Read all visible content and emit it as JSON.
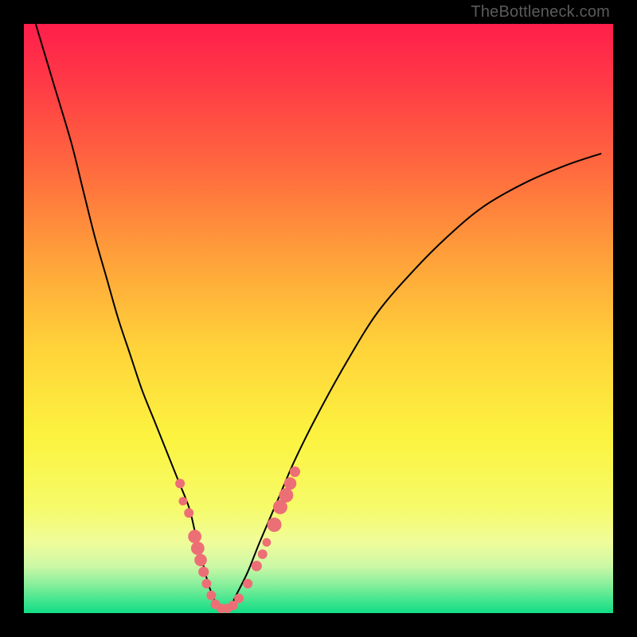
{
  "watermark": "TheBottleneck.com",
  "colors": {
    "frame_bg": "#000000",
    "curve_stroke": "#000000",
    "marker_fill": "#ED6F76",
    "marker_stroke": "#ED6F76",
    "gradient_stops": [
      {
        "pct": 0,
        "c": "#FF1E4B"
      },
      {
        "pct": 10,
        "c": "#FF3A46"
      },
      {
        "pct": 25,
        "c": "#FF6B3E"
      },
      {
        "pct": 40,
        "c": "#FFA23A"
      },
      {
        "pct": 55,
        "c": "#FFD33A"
      },
      {
        "pct": 70,
        "c": "#FCF33F"
      },
      {
        "pct": 82,
        "c": "#F6FB69"
      },
      {
        "pct": 88,
        "c": "#F0FC9A"
      },
      {
        "pct": 92,
        "c": "#CCF8A6"
      },
      {
        "pct": 95,
        "c": "#8BEF9C"
      },
      {
        "pct": 98,
        "c": "#3FE58E"
      },
      {
        "pct": 100,
        "c": "#12DC85"
      }
    ]
  },
  "chart_data": {
    "type": "line",
    "title": "",
    "xlabel": "",
    "ylabel": "",
    "xlim": [
      0,
      100
    ],
    "ylim": [
      0,
      100
    ],
    "note": "Axes are implied (no ticks). y=100 is top (red/worst), y=0 bottom (green/best). Curve depicts bottleneck % vs some x parameter.",
    "series": [
      {
        "name": "bottleneck-curve",
        "x": [
          2,
          5,
          8,
          10,
          12,
          14,
          16,
          18,
          20,
          22,
          24,
          26,
          28,
          29,
          30,
          31,
          32,
          33,
          34,
          35,
          36,
          38,
          40,
          43,
          46,
          50,
          55,
          60,
          66,
          72,
          78,
          85,
          92,
          98
        ],
        "y": [
          100,
          90,
          80,
          72,
          64,
          57,
          50,
          44,
          38,
          33,
          28,
          23,
          18,
          14,
          10,
          6,
          3,
          1,
          0.5,
          1,
          3,
          7,
          12,
          19,
          26,
          34,
          43,
          51,
          58,
          64,
          69,
          73,
          76,
          78
        ]
      }
    ],
    "markers": {
      "name": "highlighted-points",
      "points": [
        {
          "x": 26.5,
          "y": 22,
          "r": 1.0
        },
        {
          "x": 27.0,
          "y": 19,
          "r": 0.9
        },
        {
          "x": 28.0,
          "y": 17,
          "r": 1.0
        },
        {
          "x": 29.0,
          "y": 13,
          "r": 1.4
        },
        {
          "x": 29.5,
          "y": 11,
          "r": 1.4
        },
        {
          "x": 30.0,
          "y": 9,
          "r": 1.3
        },
        {
          "x": 30.5,
          "y": 7,
          "r": 1.1
        },
        {
          "x": 31.0,
          "y": 5,
          "r": 1.0
        },
        {
          "x": 31.8,
          "y": 3,
          "r": 1.0
        },
        {
          "x": 32.5,
          "y": 1.5,
          "r": 1.0
        },
        {
          "x": 33.5,
          "y": 0.8,
          "r": 1.0
        },
        {
          "x": 34.5,
          "y": 0.8,
          "r": 1.0
        },
        {
          "x": 35.5,
          "y": 1.3,
          "r": 1.0
        },
        {
          "x": 36.5,
          "y": 2.5,
          "r": 1.0
        },
        {
          "x": 38.0,
          "y": 5,
          "r": 1.0
        },
        {
          "x": 39.5,
          "y": 8,
          "r": 1.1
        },
        {
          "x": 40.5,
          "y": 10,
          "r": 1.0
        },
        {
          "x": 41.2,
          "y": 12,
          "r": 0.9
        },
        {
          "x": 42.5,
          "y": 15,
          "r": 1.5
        },
        {
          "x": 43.5,
          "y": 18,
          "r": 1.5
        },
        {
          "x": 44.5,
          "y": 20,
          "r": 1.5
        },
        {
          "x": 45.2,
          "y": 22,
          "r": 1.3
        },
        {
          "x": 46.0,
          "y": 24,
          "r": 1.1
        }
      ]
    }
  }
}
